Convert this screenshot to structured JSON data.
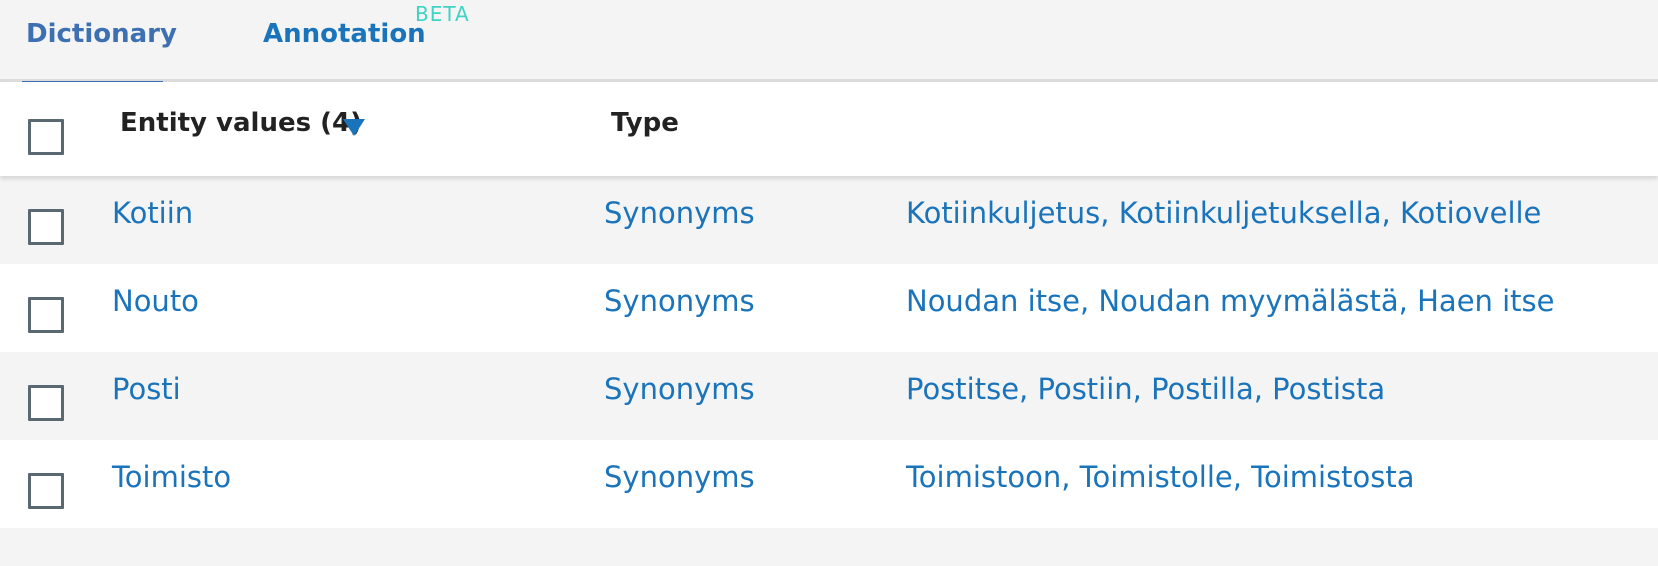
{
  "tabs": {
    "dictionary": "Dictionary",
    "annotation": "Annotation",
    "beta": "BETA"
  },
  "table": {
    "headers": {
      "entity_values": "Entity values (4)",
      "type": "Type"
    },
    "rows": [
      {
        "value": "Kotiin",
        "type": "Synonyms",
        "synonyms": "Kotiinkuljetus, Kotiinkuljetuksella, Kotiovelle"
      },
      {
        "value": "Nouto",
        "type": "Synonyms",
        "synonyms": "Noudan itse, Noudan myymälästä, Haen itse"
      },
      {
        "value": "Posti",
        "type": "Synonyms",
        "synonyms": "Postitse, Postiin, Postilla, Postista"
      },
      {
        "value": "Toimisto",
        "type": "Synonyms",
        "synonyms": "Toimistoon, Toimistolle, Toimistosta"
      }
    ]
  },
  "colors": {
    "link": "#1a74bb",
    "active_tab": "#3d70b2",
    "beta": "#3ed4c4",
    "checkbox_border": "#5a6872"
  }
}
